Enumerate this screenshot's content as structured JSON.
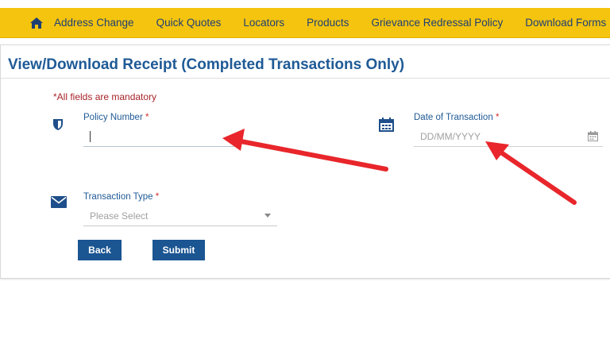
{
  "nav": {
    "home_icon": "home-icon",
    "items": [
      {
        "label": "Address Change"
      },
      {
        "label": "Quick Quotes"
      },
      {
        "label": "Locators"
      },
      {
        "label": "Products"
      },
      {
        "label": "Grievance Redressal Policy"
      },
      {
        "label": "Download Forms"
      }
    ]
  },
  "page": {
    "title": "View/Download Receipt (Completed Transactions Only)",
    "mandatory_note": "*All fields are mandatory"
  },
  "form": {
    "policy_number": {
      "label": "Policy Number",
      "required_mark": "*",
      "value": "",
      "icon": "shield-icon"
    },
    "date_of_transaction": {
      "label": "Date of Transaction",
      "required_mark": "*",
      "placeholder": "DD/MM/YYYY",
      "icon": "calendar-icon"
    },
    "transaction_type": {
      "label": "Transaction Type",
      "required_mark": "*",
      "selected": "Please Select",
      "icon": "envelope-icon"
    }
  },
  "buttons": {
    "back": "Back",
    "submit": "Submit"
  },
  "colors": {
    "nav_bg": "#f5c40f",
    "nav_text": "#1e3f72",
    "title": "#1f5a96",
    "button": "#1b5592",
    "mandatory": "#a8232a",
    "annotation_arrow": "#e8262b"
  }
}
